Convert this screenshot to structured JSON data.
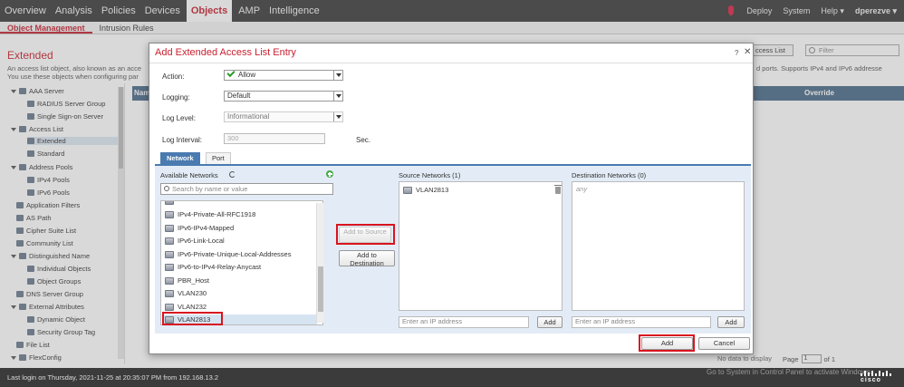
{
  "topnav": {
    "items": [
      "Overview",
      "Analysis",
      "Policies",
      "Devices",
      "Objects",
      "AMP",
      "Intelligence"
    ],
    "active": "Objects",
    "right": {
      "deploy": "Deploy",
      "system": "System",
      "help": "Help ▾",
      "user": "dperezve ▾"
    }
  },
  "subnav": {
    "items": [
      "Object Management",
      "Intrusion Rules"
    ]
  },
  "page": {
    "title": "Extended",
    "desc_line1": "An access list object, also known as an acce",
    "desc_line2": "You use these objects when configuring par",
    "desc_right": "d ports. Supports IPv4 and IPv6 addresse",
    "button_access_list": "ccess List",
    "filter_placeholder": "Filter",
    "table_col_name": "Nam",
    "table_col_override": "Override",
    "no_data": "No data to display",
    "pager_label": "Page",
    "pager_value": "1",
    "pager_of": "of 1"
  },
  "sidebar": {
    "items": [
      {
        "label": "AAA Server",
        "level": 0
      },
      {
        "label": "RADIUS Server Group",
        "level": 1
      },
      {
        "label": "Single Sign-on Server",
        "level": 1
      },
      {
        "label": "Access List",
        "level": 0
      },
      {
        "label": "Extended",
        "level": 1,
        "selected": true
      },
      {
        "label": "Standard",
        "level": 1
      },
      {
        "label": "Address Pools",
        "level": 0
      },
      {
        "label": "IPv4 Pools",
        "level": 1
      },
      {
        "label": "IPv6 Pools",
        "level": 1
      },
      {
        "label": "Application Filters",
        "level": 0
      },
      {
        "label": "AS Path",
        "level": 0
      },
      {
        "label": "Cipher Suite List",
        "level": 0
      },
      {
        "label": "Community List",
        "level": 0
      },
      {
        "label": "Distinguished Name",
        "level": 0
      },
      {
        "label": "Individual Objects",
        "level": 1
      },
      {
        "label": "Object Groups",
        "level": 1
      },
      {
        "label": "DNS Server Group",
        "level": 0
      },
      {
        "label": "External Attributes",
        "level": 0
      },
      {
        "label": "Dynamic Object",
        "level": 1
      },
      {
        "label": "Security Group Tag",
        "level": 1
      },
      {
        "label": "File List",
        "level": 0
      },
      {
        "label": "FlexConfig",
        "level": 0
      }
    ]
  },
  "modal": {
    "title": "Add Extended Access List Entry",
    "help": "?",
    "close": "✕",
    "action_label": "Action:",
    "action_value": "Allow",
    "logging_label": "Logging:",
    "logging_value": "Default",
    "log_level_label": "Log Level:",
    "log_level_value": "Informational",
    "log_interval_label": "Log Interval:",
    "log_interval_value": "300",
    "log_interval_unit": "Sec.",
    "tabs": [
      "Network",
      "Port"
    ],
    "available_label": "Available Networks",
    "search_placeholder": "Search by name or value",
    "available_networks": [
      "IPv4-Private-All-RFC1918",
      "IPv6-IPv4-Mapped",
      "IPv6-Link-Local",
      "IPv6-Private-Unique-Local-Addresses",
      "IPv6-to-IPv4-Relay-Anycast",
      "PBR_Host",
      "VLAN230",
      "VLAN232",
      "VLAN2813"
    ],
    "add_to_source": "Add to Source",
    "add_to_destination": "Add to Destination",
    "source_label": "Source Networks (1)",
    "source_items": [
      "VLAN2813"
    ],
    "destination_label": "Destination Networks (0)",
    "destination_placeholder_any": "any",
    "ip_placeholder": "Enter an IP address",
    "add_small": "Add",
    "add_button": "Add",
    "cancel_button": "Cancel"
  },
  "footer": {
    "login_text": "Last login on Thursday, 2021-11-25 at 20:35:07 PM from 192.168.13.2",
    "watermark": "Go to System in Control Panel to activate Windows.",
    "brand": "cisco"
  },
  "colors": {
    "accent": "#c8202f",
    "highlight": "#d8141f",
    "tab_active": "#4a7bb0",
    "nav_bg": "#3b3b3b"
  }
}
